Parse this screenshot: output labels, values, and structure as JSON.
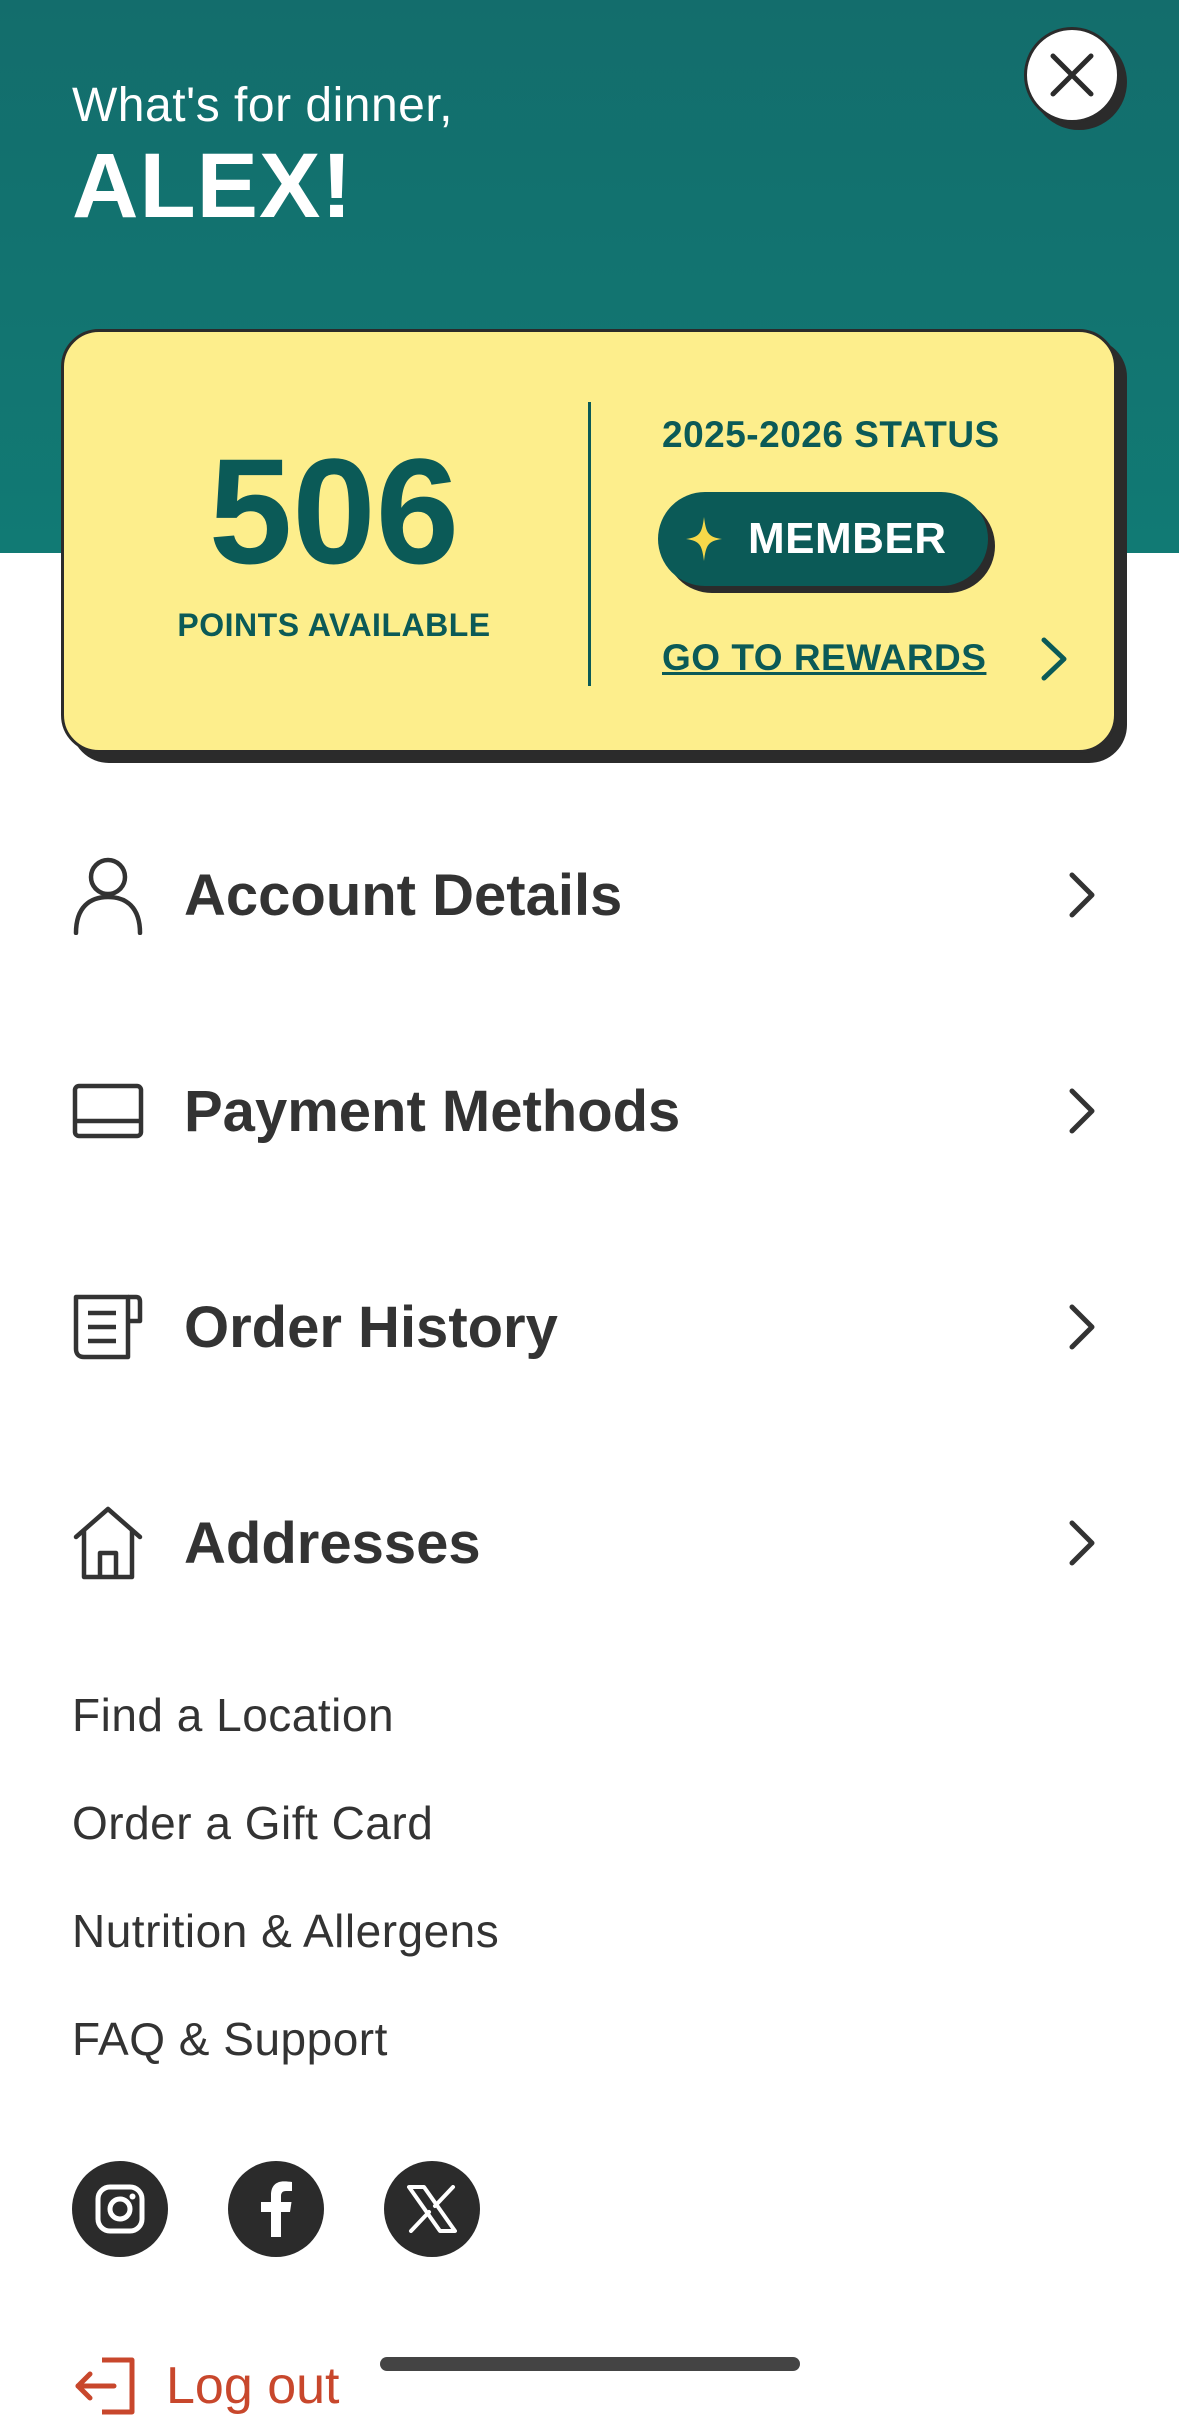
{
  "header": {
    "greeting": "What's for dinner,",
    "name": "ALEX!",
    "close_icon": "close-icon"
  },
  "rewards_card": {
    "points": "506",
    "points_label": "POINTS AVAILABLE",
    "status_label": "2025-2026 STATUS",
    "tier": "MEMBER",
    "tier_icon": "sparkle-icon",
    "link_label": "GO TO REWARDS"
  },
  "menu": [
    {
      "label": "Account Details",
      "icon": "user-icon"
    },
    {
      "label": "Payment Methods",
      "icon": "card-icon"
    },
    {
      "label": "Order History",
      "icon": "receipt-icon"
    },
    {
      "label": "Addresses",
      "icon": "home-icon"
    }
  ],
  "links": [
    "Find a Location",
    "Order a Gift Card",
    "Nutrition & Allergens",
    "FAQ & Support"
  ],
  "social": [
    {
      "name": "instagram-icon"
    },
    {
      "name": "facebook-icon"
    },
    {
      "name": "x-icon"
    }
  ],
  "logout": {
    "label": "Log out",
    "icon": "logout-icon"
  },
  "colors": {
    "teal": "#136d6c",
    "dark_teal": "#0b5a57",
    "card_yellow": "#fdee8c",
    "text": "#333333",
    "logout_red": "#c8472c"
  }
}
